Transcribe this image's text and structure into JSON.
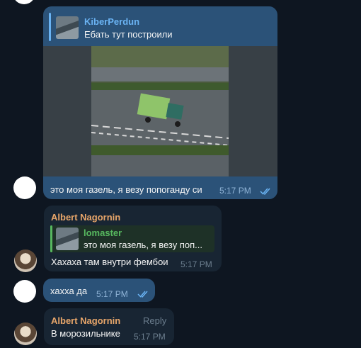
{
  "messages": [
    {
      "reply": {
        "name": "KiberPerdun",
        "text": "Ебать тут построили"
      },
      "text": "это моя газель, я везу попоганду си",
      "time": "5:17 PM"
    },
    {
      "author": "Albert Nagornin",
      "reply": {
        "name": "lomaster",
        "text": "это моя газель, я везу поп..."
      },
      "text": "Хахаха там внутри фембои",
      "time": "5:17 PM"
    },
    {
      "text": "хахха да",
      "time": "5:17 PM"
    },
    {
      "author": "Albert Nagornin",
      "action": "Reply",
      "text": "В морозильнике",
      "time": "5:17 PM"
    }
  ],
  "colors": {
    "background": "#0e1621",
    "outgoing_bubble": "#2b5278",
    "incoming_bubble": "#182533",
    "author_name": "#e8a66a",
    "reply_accent_blue": "#6ab3f3",
    "reply_accent_green": "#57b85f",
    "read_check": "#6ab3f3"
  },
  "icons": [
    "double-check-icon",
    "avatar-blank",
    "avatar-anime"
  ]
}
